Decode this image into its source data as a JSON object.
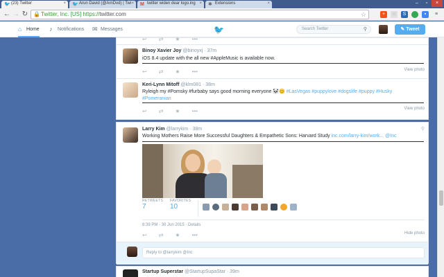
{
  "browser": {
    "tabs": [
      {
        "title": "(23) Twitter",
        "active": true
      },
      {
        "title": "Arun David (@ArnDvd) | Twi",
        "active": false
      },
      {
        "title": "twitter widen dear logo.ing",
        "active": false
      },
      {
        "title": "Extensions",
        "active": false
      }
    ],
    "ev_label": "Twitter, Inc. [US]",
    "url_scheme": "https://",
    "url_host": "twitter.com"
  },
  "nav": {
    "home": "Home",
    "notifications": "Notifications",
    "messages": "Messages",
    "search_placeholder": "Search Twitter",
    "tweet_button": "Tweet"
  },
  "timeline": {
    "view_photo": "View photo",
    "hide_photo": "Hide photo",
    "tweets": [
      {
        "name": "Binoy Xavier Joy",
        "handle": "@binoyxj · 37m",
        "text": "iOS 8.4 update with the all new #AppleMusic is available now."
      },
      {
        "name": "Keri-Lynn Mitoff",
        "handle": "@klm081 · 38m",
        "text_prefix": "Ryleigh my #Pomsky #furbaby says good morning everyone",
        "text_tags_1": "#LasVegas #puppylove #dogslife #puppy #Husky",
        "text_tags_2": "#Pomeranian"
      },
      {
        "name": "Larry Kim",
        "handle": "@larrykim · 38m",
        "text": "Working Mothers Raise More Successful Daughters & Empathetic Sons: Harvard Study",
        "link": "inc.com/larry-kim/work...",
        "via": "@Inc",
        "retweets_label": "RETWEETS",
        "retweets": "7",
        "favorites_label": "FAVORITES",
        "favorites": "10",
        "timestamp": "8:39 PM - 30 Jun 2015 · Details",
        "reply_placeholder": "Reply to @larrykim @Inc"
      },
      {
        "name": "Startup Superstar",
        "handle": "@StartupSupaStar · 39m"
      }
    ]
  },
  "colors": {
    "background": "#4a6da7",
    "accent": "#55acee",
    "text": "#292f33",
    "muted": "#8899a6"
  }
}
